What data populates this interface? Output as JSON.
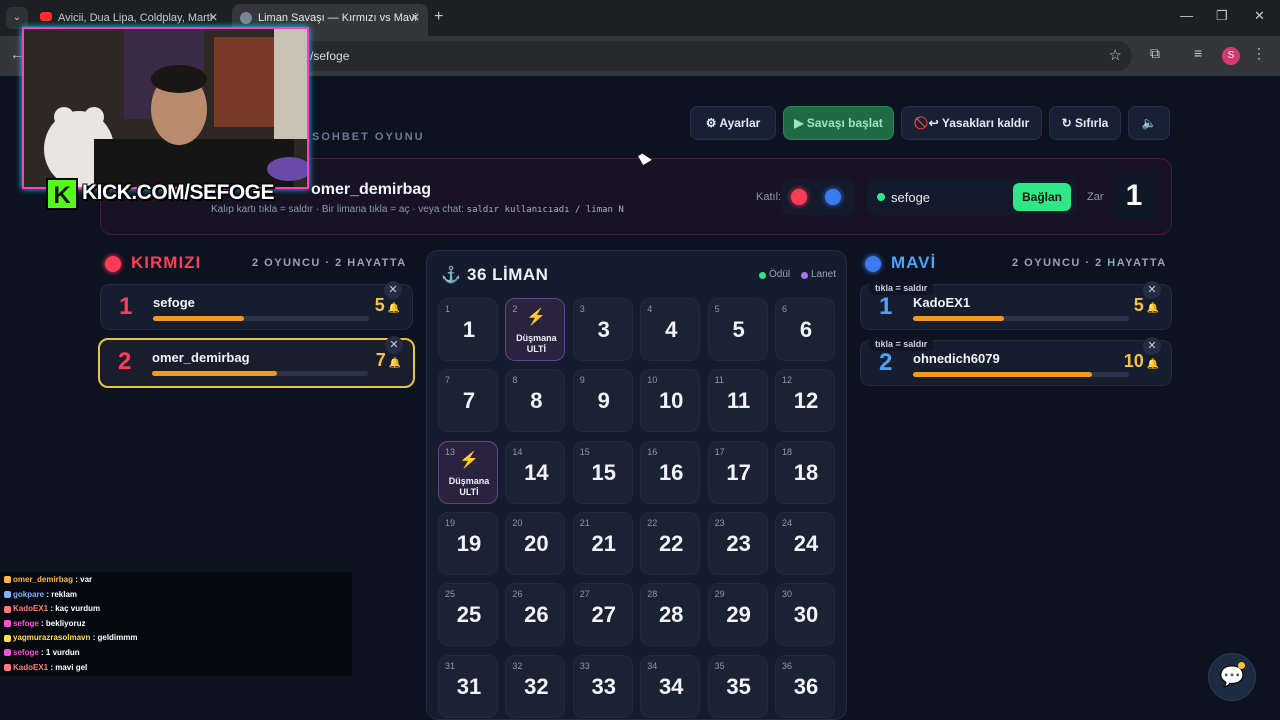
{
  "browser": {
    "tabs": [
      {
        "title": "Avicii, Dua Lipa, Coldplay, Marti"
      },
      {
        "title": "Liman Savaşı — Kırmızı vs Mavi"
      }
    ],
    "new_tab": "+",
    "url": "/sefoge",
    "profile_initial": "S"
  },
  "toolbar": {
    "settings": "⚙ Ayarlar",
    "start": "▶ Savaşı başlat",
    "unban": "🚫↩ Yasakları kaldır",
    "reset": "↻ Sıfırla",
    "sound": "🔈"
  },
  "subtitle": "SOHBET OYUNU",
  "header": {
    "player_name": "omer_demirbag",
    "hint_prefix": "Kalıp kartı tıkla = saldır · Bir limana tıkla = aç · veya chat:",
    "hint_code": "saldır kullanıcıadı / liman N",
    "join_label": "Katıl:",
    "username_value": "sefoge",
    "connect_label": "Bağlan",
    "dice_label": "Zar",
    "dice_value": "1"
  },
  "red_team": {
    "title": "KIRMIZI",
    "count": "2 OYUNCU · 2 HAYATTA",
    "color": "#ff3b55",
    "players": [
      {
        "rank": "1",
        "name": "sefoge",
        "lives": "5",
        "progress": 0.42,
        "close": "✕"
      },
      {
        "rank": "2",
        "name": "omer_demirbag",
        "lives": "7",
        "progress": 0.58,
        "close": "✕"
      }
    ]
  },
  "blue_team": {
    "title": "MAVİ",
    "count": "2 OYUNCU · 2 HAYATTA",
    "color": "#3f7bf0",
    "players": [
      {
        "rank": "1",
        "name": "KadoEX1",
        "lives": "5",
        "progress": 0.42,
        "close": "✕",
        "tag": "tıkla = saldır"
      },
      {
        "rank": "2",
        "name": "ohnedich6079",
        "lives": "10",
        "progress": 0.83,
        "close": "✕",
        "tag": "tıkla = saldır"
      }
    ]
  },
  "board": {
    "title": "36 LİMAN",
    "legend_reward": "Ödül",
    "legend_curse": "Lanet",
    "ulti_label": "Düşmana ULTİ",
    "ulti_icon": "lightning-icon",
    "cells": [
      "1",
      "2",
      "3",
      "4",
      "5",
      "6",
      "7",
      "8",
      "9",
      "10",
      "11",
      "12",
      "13",
      "14",
      "15",
      "16",
      "17",
      "18",
      "19",
      "20",
      "21",
      "22",
      "23",
      "24",
      "25",
      "26",
      "27",
      "28",
      "29",
      "30",
      "31",
      "32",
      "33",
      "34",
      "35",
      "36"
    ],
    "ulti_cells": [
      "2",
      "13"
    ]
  },
  "overlay": {
    "kick_letter": "K",
    "kick_text": "KICK.COM/SEFOGE"
  },
  "chat": [
    {
      "user": "omer_demirbag",
      "msg": "var",
      "color": "#ffb74a"
    },
    {
      "user": "gokpare",
      "msg": "reklam",
      "color": "#7fb0ff"
    },
    {
      "user": "KadoEX1",
      "msg": "kaç vurdum",
      "color": "#ff7a7a"
    },
    {
      "user": "sefoge",
      "msg": "bekliyoruz",
      "color": "#ff4fd8"
    },
    {
      "user": "yagmurazrasolmavn",
      "msg": "geldimmm",
      "color": "#ffe14a"
    },
    {
      "user": "sefoge",
      "msg": "1 vurdun",
      "color": "#ff4fd8"
    },
    {
      "user": "KadoEX1",
      "msg": "mavi gel",
      "color": "#ff7a7a"
    }
  ]
}
